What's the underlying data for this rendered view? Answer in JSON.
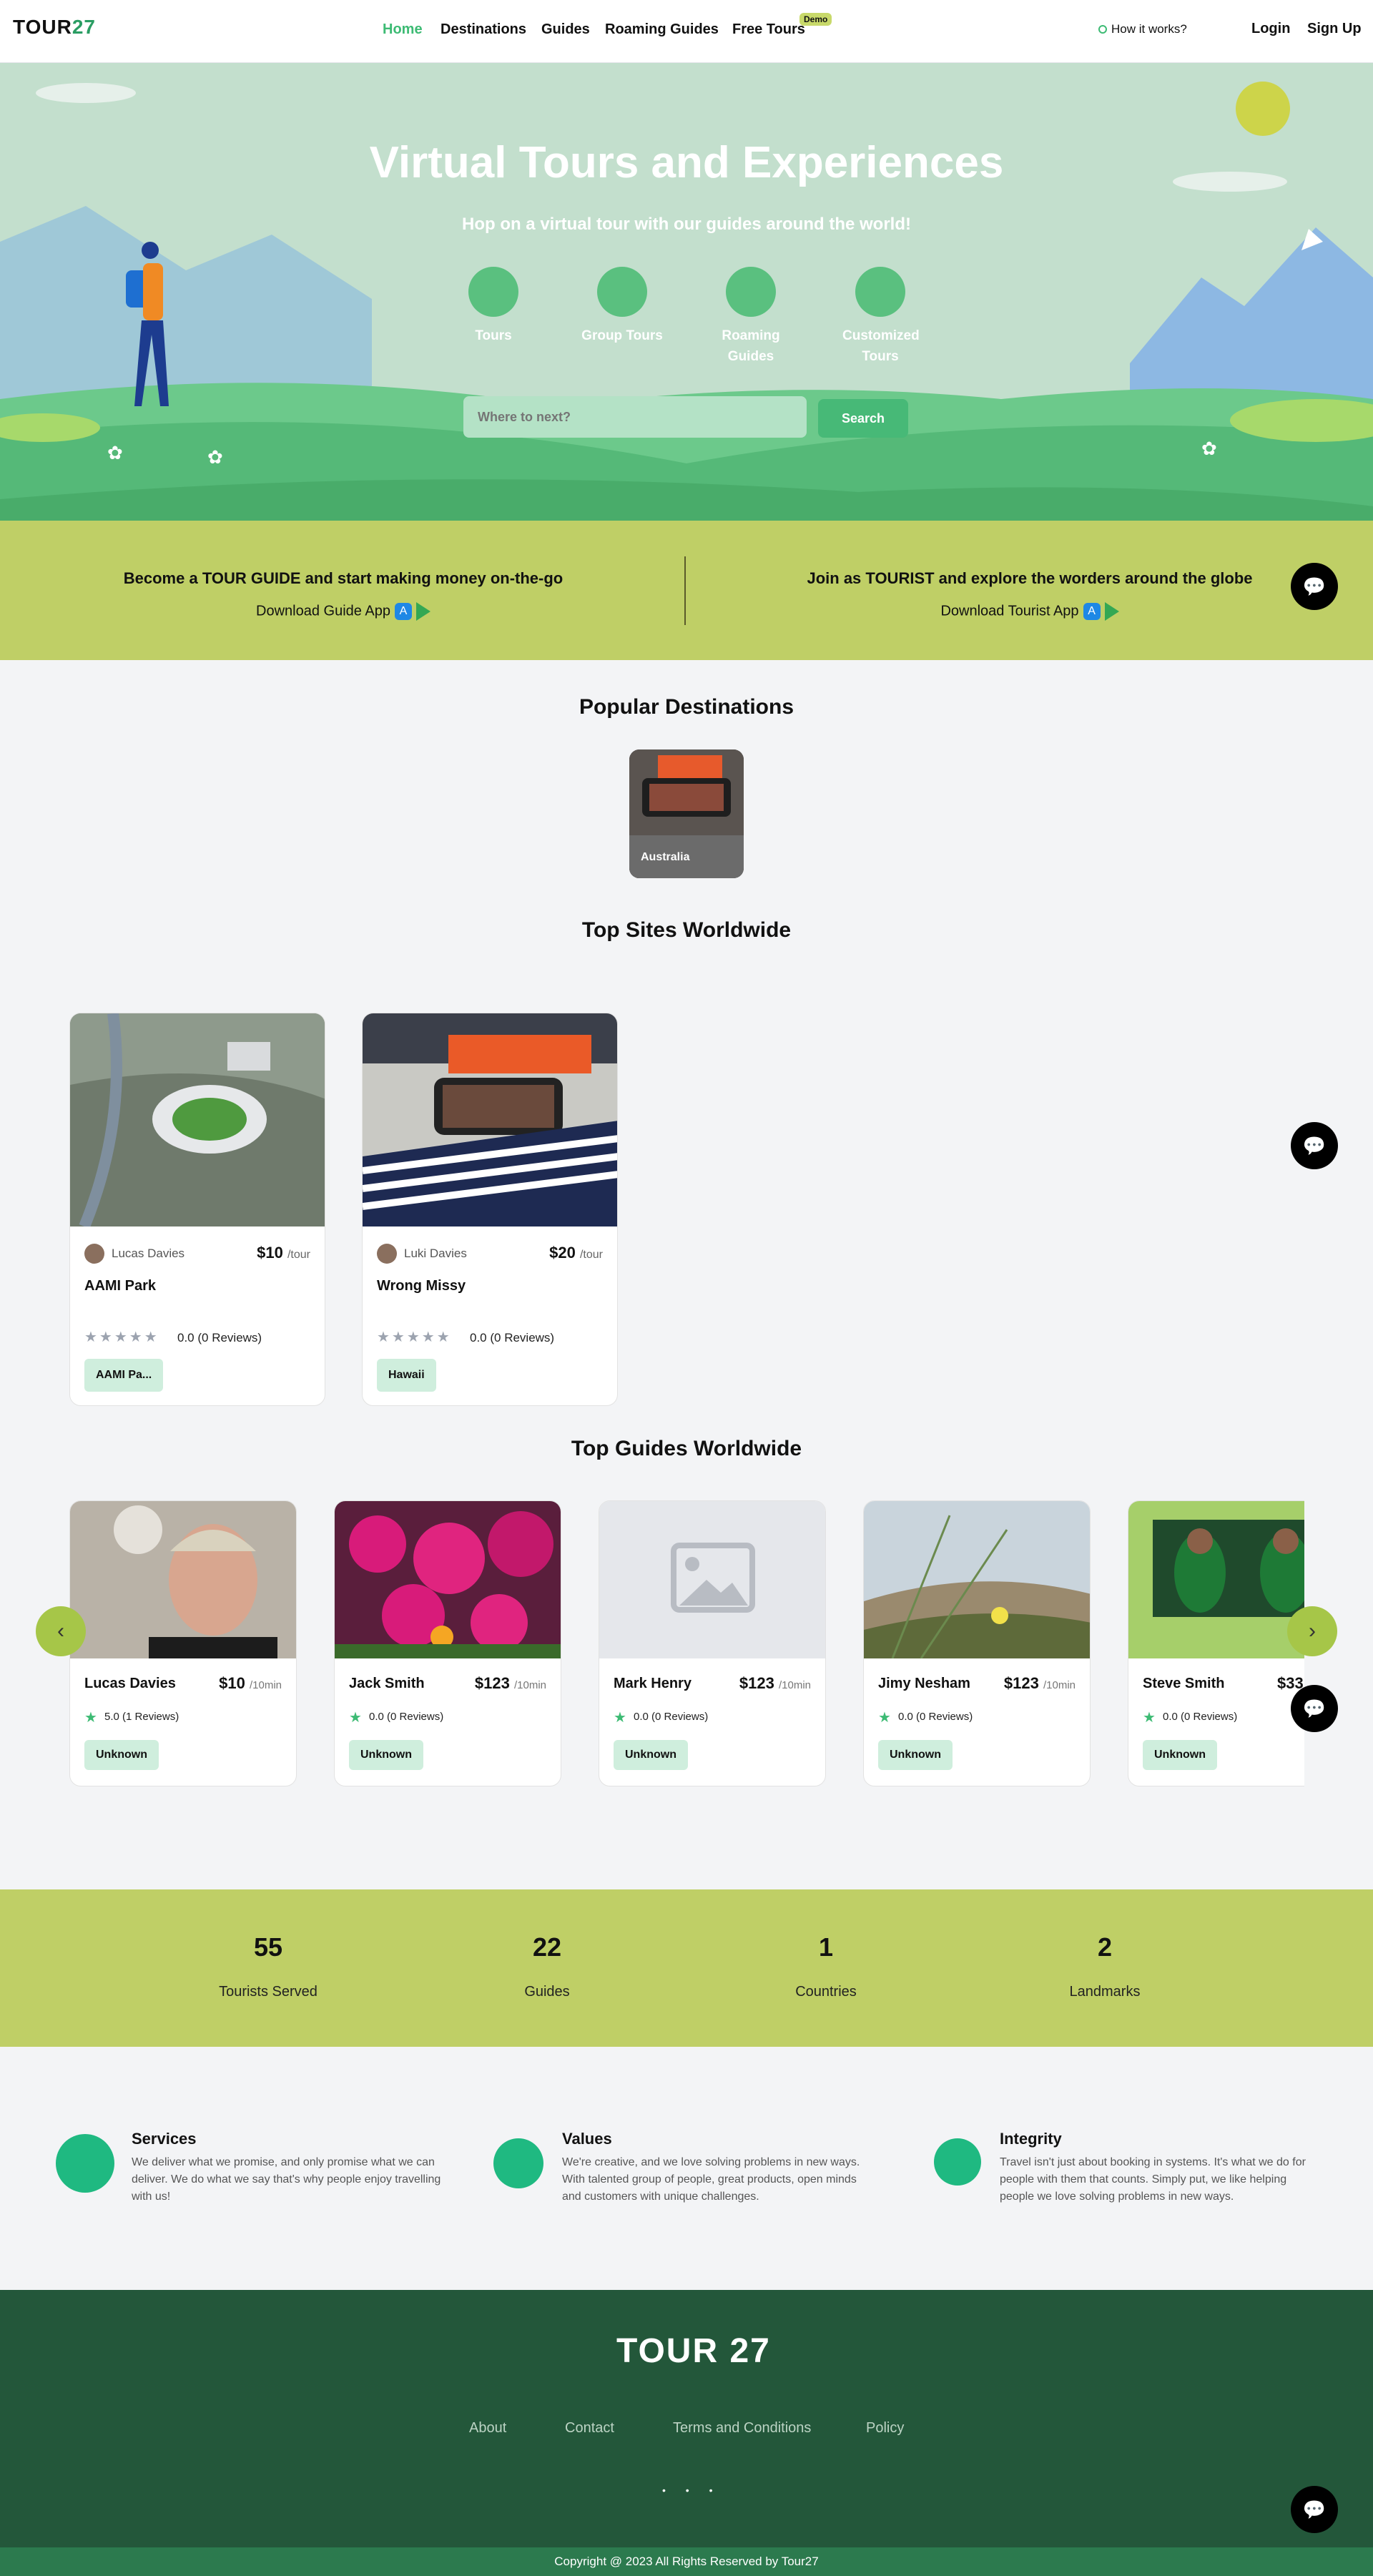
{
  "header": {
    "logo_text": "TOUR",
    "logo_num": "27",
    "nav": [
      "Home",
      "Destinations",
      "Guides",
      "Roaming Guides",
      "Free Tours"
    ],
    "demo_badge": "Demo",
    "how_it_works": "How it works?",
    "login": "Login",
    "signup": "Sign Up"
  },
  "hero": {
    "title": "Virtual Tours and Experiences",
    "subtitle": "Hop on a virtual tour with our guides around the world!",
    "categories": [
      "Tours",
      "Group Tours",
      "Roaming Guides",
      "Customized Tours"
    ],
    "search_placeholder": "Where to next?",
    "search_button": "Search"
  },
  "banner": {
    "guide_pre": "Become a ",
    "guide_bold": "TOUR GUIDE",
    "guide_post": " and start making money on-the-go",
    "guide_download": "Download Guide App",
    "tourist_pre": "Join as ",
    "tourist_bold": "TOURIST",
    "tourist_post": " and explore the worders around the globe",
    "tourist_download": "Download Tourist App"
  },
  "popular": {
    "title": "Popular Destinations",
    "items": [
      {
        "label": "Australia"
      }
    ]
  },
  "sites": {
    "title": "Top Sites Worldwide",
    "items": [
      {
        "guide": "Lucas Davies",
        "price": "$10",
        "unit": "/tour",
        "title": "AAMI Park",
        "rating": "0.0 (0 Reviews)",
        "tag": "AAMI Pa..."
      },
      {
        "guide": "Luki Davies",
        "price": "$20",
        "unit": "/tour",
        "title": "Wrong Missy",
        "rating": "0.0 (0 Reviews)",
        "tag": "Hawaii"
      }
    ]
  },
  "guides": {
    "title": "Top Guides Worldwide",
    "items": [
      {
        "name": "Lucas Davies",
        "price": "$10",
        "unit": "/10min",
        "rating": "5.0 (1 Reviews)",
        "tag": "Unknown"
      },
      {
        "name": "Jack Smith",
        "price": "$123",
        "unit": "/10min",
        "rating": "0.0 (0 Reviews)",
        "tag": "Unknown"
      },
      {
        "name": "Mark Henry",
        "price": "$123",
        "unit": "/10min",
        "rating": "0.0 (0 Reviews)",
        "tag": "Unknown"
      },
      {
        "name": "Jimy Nesham",
        "price": "$123",
        "unit": "/10min",
        "rating": "0.0 (0 Reviews)",
        "tag": "Unknown"
      },
      {
        "name": "Steve Smith",
        "price": "$33",
        "unit": "",
        "rating": "0.0 (0 Reviews)",
        "tag": "Unknown"
      }
    ]
  },
  "stats": [
    {
      "value": "55",
      "label": "Tourists Served"
    },
    {
      "value": "22",
      "label": "Guides"
    },
    {
      "value": "1",
      "label": "Countries"
    },
    {
      "value": "2",
      "label": "Landmarks"
    }
  ],
  "values": [
    {
      "title": "Services",
      "text": "We deliver what we promise, and only promise what we can deliver. We do what we say that's why people enjoy travelling with us!"
    },
    {
      "title": "Values",
      "text": "We're creative, and we love solving problems in new ways. With talented group of people, great products, open minds and customers with unique challenges."
    },
    {
      "title": "Integrity",
      "text": "Travel isn't just about booking in systems. It's what we do for people with them that counts. Simply put, we like helping people we love solving problems in new ways."
    }
  ],
  "footer": {
    "logo": "TOUR 27",
    "links": [
      "About",
      "Contact",
      "Terms and Conditions",
      "Policy"
    ],
    "dots": "• • •",
    "copyright": "Copyright @ 2023 All Rights Reserved by Tour27"
  },
  "colors": {
    "accent": "#3dbb74",
    "banner": "#bfcf66",
    "footer": "#23573a"
  }
}
